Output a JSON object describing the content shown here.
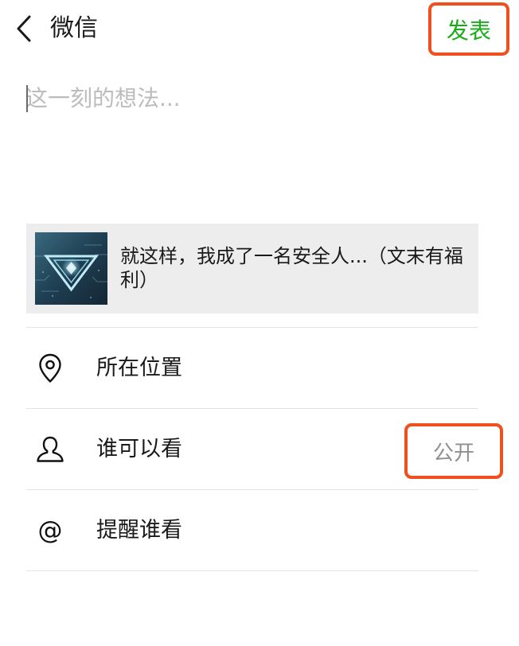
{
  "header": {
    "back_icon": "chevron-left-icon",
    "title": "微信",
    "publish_label": "发表",
    "publish_color": "#1aad19",
    "highlight_color": "#f0501e"
  },
  "composer": {
    "placeholder": "这一刻的想法...",
    "value": ""
  },
  "share_card": {
    "thumbnail_icon": "diamond-logo-thumbnail",
    "title": "就这样，我成了一名安全人...（文末有福利）"
  },
  "options": [
    {
      "icon": "location-pin-icon",
      "label": "所在位置",
      "value": ""
    },
    {
      "icon": "person-icon",
      "label": "谁可以看",
      "value": "公开"
    },
    {
      "icon": "at-sign-icon",
      "label": "提醒谁看",
      "value": ""
    }
  ]
}
